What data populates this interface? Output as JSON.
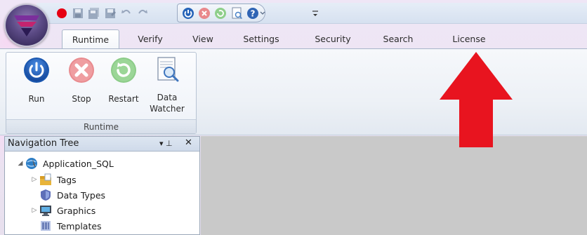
{
  "quick_access": {
    "items": [
      "record-icon",
      "save-icon",
      "save-all-icon",
      "save-as-icon",
      "undo-icon",
      "redo-icon",
      "run-icon",
      "stop-icon",
      "restart-icon",
      "data-watcher-icon",
      "help-icon",
      "customize-icon"
    ]
  },
  "ribbon": {
    "tabs": [
      "Runtime",
      "Verify",
      "View",
      "Settings",
      "Security",
      "Search",
      "License"
    ],
    "active_tab": "Runtime",
    "group": {
      "label": "Runtime",
      "buttons": [
        {
          "label": "Run",
          "icon": "power-icon"
        },
        {
          "label": "Stop",
          "icon": "stop-icon"
        },
        {
          "label": "Restart",
          "icon": "restart-icon"
        },
        {
          "label_line1": "Data",
          "label_line2": "Watcher",
          "icon": "data-watcher-icon"
        }
      ]
    }
  },
  "navigation_tree": {
    "title": "Navigation Tree",
    "pin_glyph": "▾ ⊥",
    "close_glyph": "✕",
    "items": [
      {
        "label": "Application_SQL",
        "icon": "application-globe-icon",
        "expanded": true
      },
      {
        "label": "Tags",
        "icon": "tags-folder-icon",
        "expandable": true
      },
      {
        "label": "Data Types",
        "icon": "data-types-shield-icon"
      },
      {
        "label": "Graphics",
        "icon": "graphics-monitor-icon",
        "expandable": true
      },
      {
        "label": "Templates",
        "icon": "templates-icon"
      }
    ]
  },
  "colors": {
    "annotation_arrow": "#e8141f",
    "workspace": "#c9c9c9",
    "orb": "#5b4a85"
  }
}
